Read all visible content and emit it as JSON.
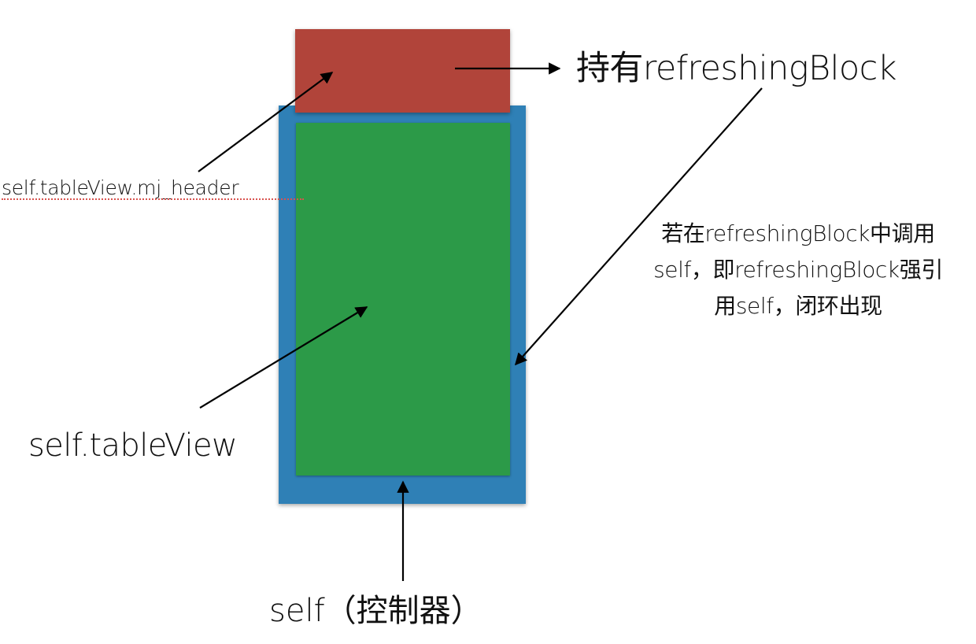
{
  "colors": {
    "header_box": "#b1443a",
    "controller_box": "#2f80b6",
    "tableview_box": "#2c9a48",
    "arrow": "#000000",
    "underline": "#d9534f"
  },
  "labels": {
    "header": "self.tableView.mj_header",
    "holds_block": "持有refreshingBlock",
    "table_view": "self.tableView",
    "controller": "self（控制器）",
    "cycle_note": [
      "若在refreshingBlock中调用",
      "self，即refreshingBlock强引",
      "用self，闭环出现"
    ]
  }
}
